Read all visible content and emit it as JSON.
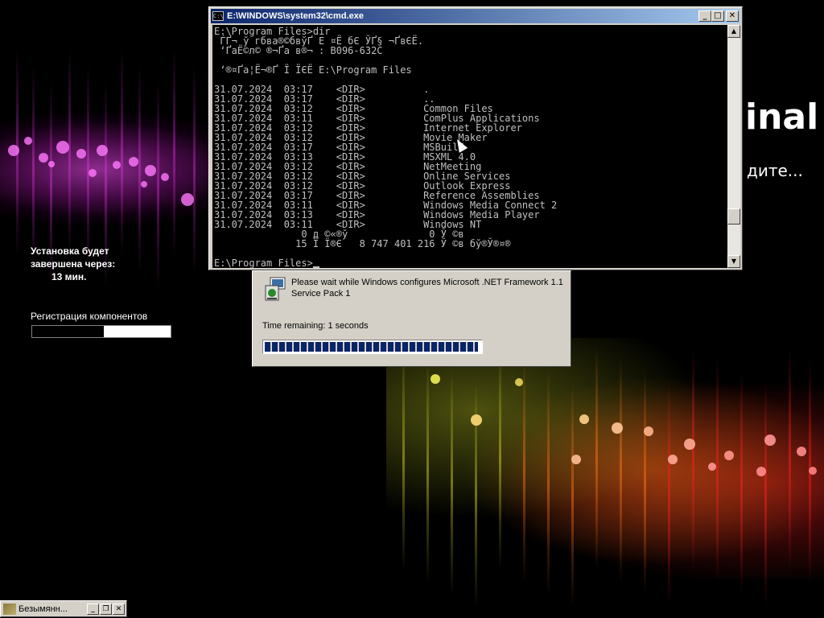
{
  "desktop": {
    "bg_text_1": "inal",
    "bg_text_2": "дите...",
    "setup_status": {
      "line1": "Установка будет",
      "line2": "завершена через:",
      "minutes": "13 мин."
    },
    "registration": {
      "label": "Регистрация компонентов",
      "progress": 0.52
    }
  },
  "cmd": {
    "title": "E:\\WINDOWS\\system32\\cmd.exe",
    "icon_text": "C:\\",
    "lines": [
      "E:\\Program Files>dir",
      " ЃҐ¬ ў гбва®©бвўҐ E ¤Ё бЄ ЎҐ§ ¬ҐвЄЁ.",
      " ‘ҐаЁ©­л© ­®¬Ґа в®¬ : B096-632C",
      "",
      " ‘®¤Ґа¦Ё¬®Ґ Ї ЇЄЁ E:\\Program Files",
      "",
      "31.07.2024  03:17    <DIR>          .",
      "31.07.2024  03:17    <DIR>          ..",
      "31.07.2024  03:12    <DIR>          Common Files",
      "31.07.2024  03:11    <DIR>          ComPlus Applications",
      "31.07.2024  03:12    <DIR>          Internet Explorer",
      "31.07.2024  03:12    <DIR>          Movie Maker",
      "31.07.2024  03:17    <DIR>          MSBuild",
      "31.07.2024  03:13    <DIR>          MSXML 4.0",
      "31.07.2024  03:12    <DIR>          NetMeeting",
      "31.07.2024  03:12    <DIR>          Online Services",
      "31.07.2024  03:12    <DIR>          Outlook Express",
      "31.07.2024  03:17    <DIR>          Reference Assemblies",
      "31.07.2024  03:11    <DIR>          Windows Media Connect 2",
      "31.07.2024  03:13    <DIR>          Windows Media Player",
      "31.07.2024  03:11    <DIR>          Windows NT",
      "               0 д ©«®ў              0 Ў ©в",
      "              15 Ї Ї®Є   8 747 401 216 Ў ©в бў®Ў®¤­®",
      "",
      "E:\\Program Files>"
    ]
  },
  "net_dialog": {
    "message": "Please wait while Windows configures Microsoft .NET Framework 1.1 Service Pack 1",
    "time_remaining": "Time remaining: 1 seconds",
    "progress": 0.99
  },
  "taskbar": {
    "label": "Безымянн...",
    "min": "_",
    "restore": "❐",
    "close": "✕"
  },
  "window_buttons": {
    "min": "_",
    "max": "□",
    "close": "✕"
  }
}
